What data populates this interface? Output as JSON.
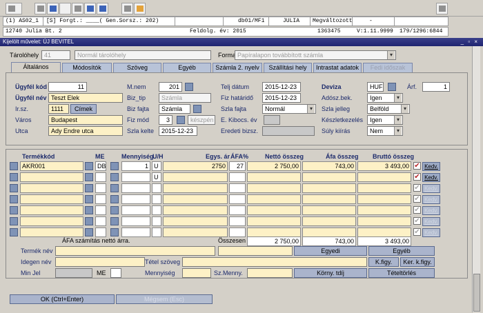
{
  "toolbar": {
    "icons": [
      "edit-icon",
      "print-icon",
      "print-settings-icon",
      "blank-icon",
      "edit-doc-icon",
      "copy-icon",
      "refresh-icon",
      "mail-icon",
      "export-icon",
      "close-icon"
    ]
  },
  "status1": {
    "session": "(1) AS02_1",
    "form": "[S] Forgt.: ____( Gen.Sorsz.: 202)",
    "db": "db01/MF1",
    "user": "JULIA",
    "modified_label": "Megváltozott",
    "modified_value": "-"
  },
  "status2": {
    "partner": "12740   Julia Bt. 2",
    "year": "Feldolg. év: 2015",
    "code": "1363475",
    "version": "V:1.11.9999",
    "counter": "179/1296:6844"
  },
  "window": {
    "title": "Kijelölt művelet: ÚJ BEVITEL",
    "controls": "_ ▫ ×"
  },
  "top": {
    "tarolohely_label": "Tárolóhely",
    "tarolohely_code": "41",
    "tarolohely_name": "Normál tárolóhely",
    "forma_label": "Forma",
    "forma_value": "Papíralapon továbbított számla"
  },
  "tabs": [
    "Általános",
    "Módosítók",
    "Szöveg",
    "Egyéb",
    "Számla 2. nyelv",
    "Szállítási hely",
    "Intrastat adatok",
    "Fedi időszak"
  ],
  "form": {
    "ugyfel_kod_label": "Ügyfél kód",
    "ugyfel_kod": "11",
    "ugyfel_nev_label": "Ügyfél név",
    "ugyfel_nev": "Teszt Elek",
    "irsz_label": "Ir.sz.",
    "irsz": "1111",
    "cimek_button": "Címek",
    "varos_label": "Város",
    "varos": "Budapest",
    "utca_label": "Utca",
    "utca": "Ady Endre utca",
    "mnem_label": "M.nem",
    "mnem": "201",
    "biztip_label": "Biz_tip",
    "biztip": "Számla",
    "bizfajta_label": "Biz fajta",
    "bizfajta": "Számla",
    "fizmod_label": "Fiz mód",
    "fizmod": "3",
    "fizmod_text": "készpén",
    "szlakelte_label": "Szla kelte",
    "szlakelte": "2015-12-23",
    "teljdatum_label": "Telj dátum",
    "teljdatum": "2015-12-23",
    "fizhatarido_label": "Fiz határidő",
    "fizhatarido": "2015-12-23",
    "szlafajta_label": "Szla fajta",
    "szlafajta": "Normál",
    "ekibocs_label": "E. Kibocs. év",
    "eredetibizsz_label": "Eredeti bizsz.",
    "deviza_label": "Deviza",
    "deviza": "HUF",
    "arf_label": "Árf.",
    "arf": "1",
    "adoszbek_label": "Adósz.bek.",
    "adoszbek": "Igen",
    "szlajelleg_label": "Szla jelleg",
    "szlajelleg": "Belföld",
    "keszletkezeles_label": "Készletkezelés",
    "keszletkezeles": "Igen",
    "sulykiiratas_label": "Súly kiírás",
    "sulykiiratas": "Nem"
  },
  "grid": {
    "headers": {
      "termekkod": "Termékkód",
      "me": "ME",
      "mennyiseg": "Mennyiség",
      "uh": "U/H",
      "egysar": "Egys. ár",
      "afa": "ÁFA%",
      "netto": "Nettó összeg",
      "afaosszeg": "Áfa összeg",
      "brutto": "Bruttó összeg"
    },
    "rows": [
      {
        "termekkod": "AKR001",
        "me": "DB",
        "mennyiseg": "1",
        "uh": "U",
        "egysar": "2750",
        "afa": "27",
        "netto": "2 750,00",
        "afaosszeg": "743,00",
        "brutto": "3 493,00",
        "checked": true
      },
      {
        "termekkod": "",
        "me": "",
        "mennyiseg": "",
        "uh": "U",
        "egysar": "",
        "afa": "",
        "netto": "",
        "afaosszeg": "",
        "brutto": "",
        "checked": true
      },
      {
        "termekkod": "",
        "me": "",
        "mennyiseg": "",
        "uh": "",
        "egysar": "",
        "afa": "",
        "netto": "",
        "afaosszeg": "",
        "brutto": "",
        "checked": true
      },
      {
        "termekkod": "",
        "me": "",
        "mennyiseg": "",
        "uh": "",
        "egysar": "",
        "afa": "",
        "netto": "",
        "afaosszeg": "",
        "brutto": "",
        "checked": true
      },
      {
        "termekkod": "",
        "me": "",
        "mennyiseg": "",
        "uh": "",
        "egysar": "",
        "afa": "",
        "netto": "",
        "afaosszeg": "",
        "brutto": "",
        "checked": true
      },
      {
        "termekkod": "",
        "me": "",
        "mennyiseg": "",
        "uh": "",
        "egysar": "",
        "afa": "",
        "netto": "",
        "afaosszeg": "",
        "brutto": "",
        "checked": true
      },
      {
        "termekkod": "",
        "me": "",
        "mennyiseg": "",
        "uh": "",
        "egysar": "",
        "afa": "",
        "netto": "",
        "afaosszeg": "",
        "brutto": "",
        "checked": true
      }
    ],
    "edit_label": "Kedv.",
    "afa_szamitas_label": "ÁFA számítás nettó árra.",
    "osszesen_label": "Összesen",
    "total_netto": "2 750,00",
    "total_afa": "743,00",
    "total_brutto": "3 493,00"
  },
  "bottom": {
    "termeknev_label": "Termék név",
    "idegennev_label": "Idegen név",
    "tetelszoveg_label": "Tétel szöveg",
    "minjel_label": "Min Jel",
    "me_label": "ME",
    "mennyiseg_label": "Mennyiség",
    "szmenny_label": "Sz.Menny.",
    "egyedi_button": "Egyedi",
    "egyeb_button": "Egyéb",
    "kfigy_button": "K.figy.",
    "kerkfigy_button": "Ker. k.figy.",
    "kornytdij_button": "Körny. tdíj",
    "teteltorles_button": "Tételtörlés"
  },
  "footer": {
    "ok_button": "OK (Ctrl+Enter)",
    "megsem_button": "Mégsem (Esc)"
  },
  "colors": {
    "field_yellow": "#fdf1c6",
    "button_blue": "#aab4cc",
    "title_bar": "#1f2470",
    "label_blue": "#1c2a6b"
  }
}
